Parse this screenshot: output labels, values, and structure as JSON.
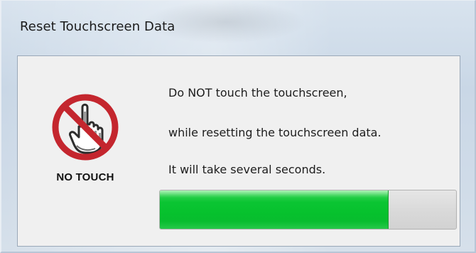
{
  "window": {
    "title": "Reset Touchscreen Data"
  },
  "icon": {
    "name": "no-touch-icon",
    "label": "NO TOUCH",
    "colors": {
      "ring": "#c4262e",
      "hand": "#3a3a3a"
    }
  },
  "message": {
    "line1": "Do NOT touch the touchscreen,",
    "line2": "while resetting the touchscreen data.",
    "line3": "It will take several seconds."
  },
  "progress": {
    "percent": 77,
    "fill_color": "#06c12d"
  }
}
